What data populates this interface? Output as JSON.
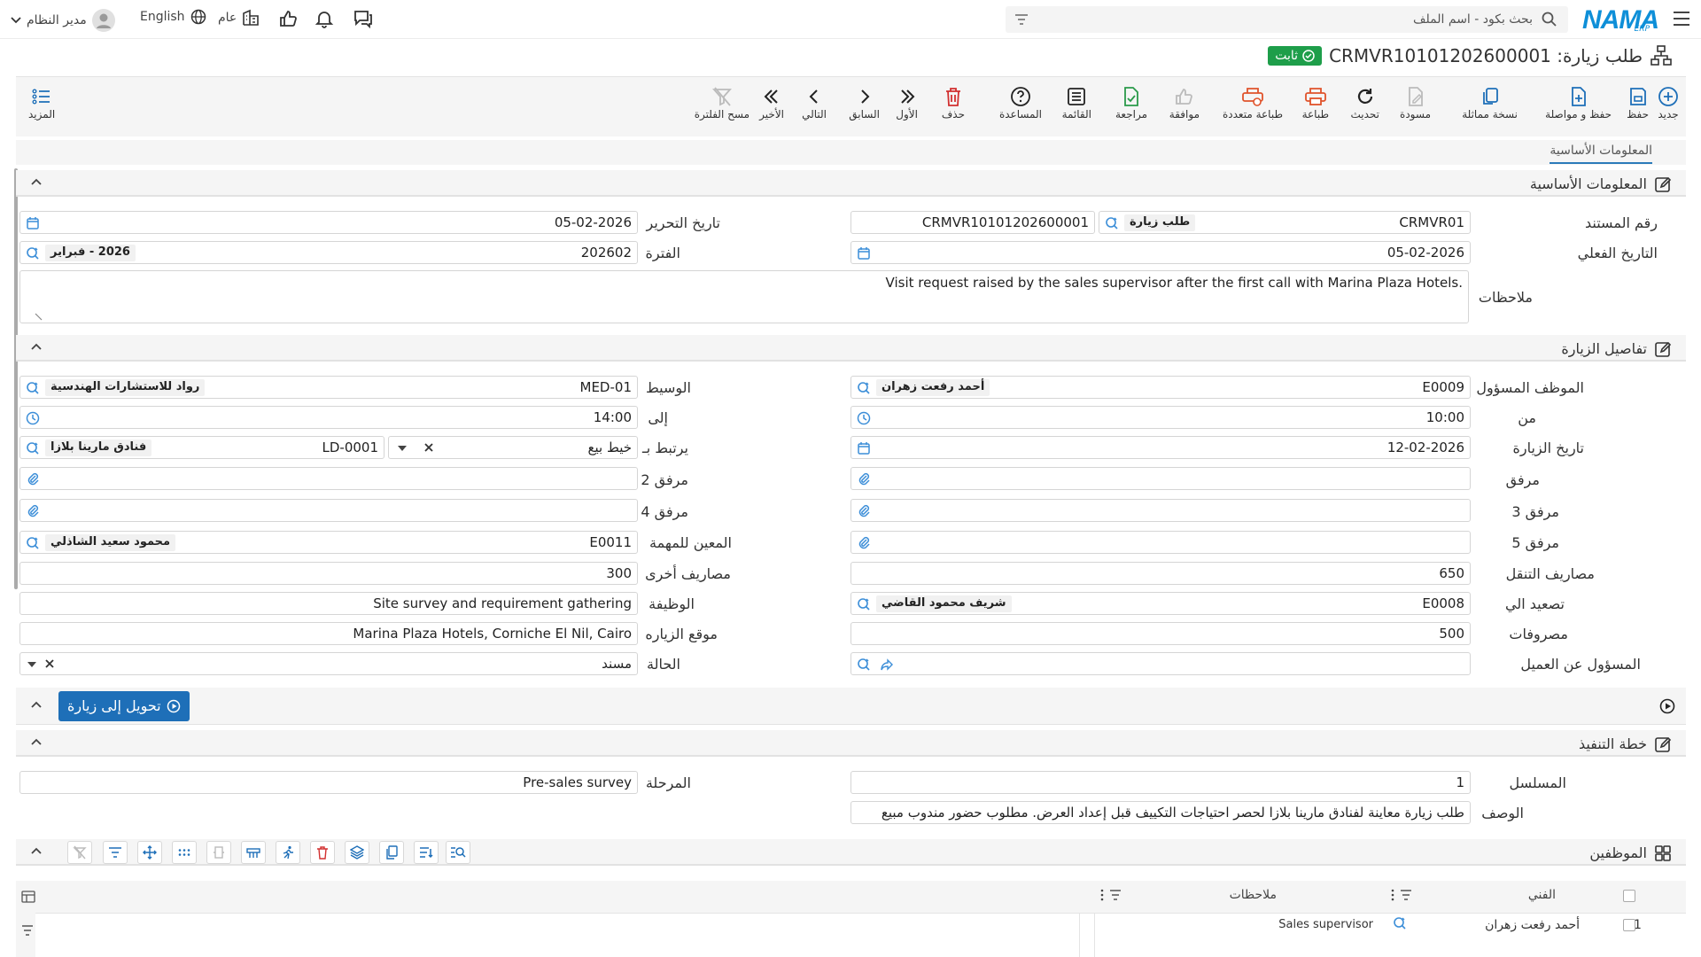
{
  "topbar": {
    "search_placeholder": "بحث بكود - اسم الملف",
    "user": "مدير النظام",
    "language": "English",
    "scope": "عام",
    "logo": "NAMA",
    "logo_sub": "ERP"
  },
  "title": {
    "text": "طلب زيارة: CRMVR10101202600001",
    "status": "ثابت"
  },
  "toolbar": {
    "new": "جديد",
    "save": "حفظ",
    "save_continue": "حفظ و مواصلة",
    "copy": "نسخة مماثلة",
    "draft": "مسودة",
    "refresh": "تحديث",
    "print": "طباعة",
    "multi_print": "طباعة متعددة",
    "approve": "موافقة",
    "review": "مراجعة",
    "list": "القائمة",
    "help": "المساعدة",
    "delete": "حذف",
    "first": "الأول",
    "prev": "السابق",
    "next": "التالي",
    "last": "الأخير",
    "clear_filter": "مسح الفلترة",
    "more": "المزيد"
  },
  "tabs": [
    "المعلومات الأساسية"
  ],
  "sections": {
    "basic": "المعلومات الأساسية",
    "visit": "تفاصيل الزيارة",
    "plan": "خطة التنفيذ",
    "employees": "الموظفين"
  },
  "basic": {
    "doc_no_label": "رقم المستند",
    "doc_code": "CRMVR01",
    "doc_type": "طلب زيارة",
    "doc_no": "CRMVR10101202600001",
    "edit_date_label": "تاريخ التحرير",
    "edit_date": "05-02-2026",
    "actual_date_label": "التاريخ الفعلي",
    "actual_date": "05-02-2026",
    "period_label": "الفترة",
    "period_code": "202602",
    "period_name": "2026 - فبراير",
    "notes_label": "ملاحظات",
    "notes": "Visit request raised by the sales supervisor after the first call with Marina Plaza Hotels."
  },
  "visit": {
    "employee_label": "الموظف المسؤول",
    "employee_code": "E0009",
    "employee_name": "أحمد رفعت زهران",
    "broker_label": "الوسيط",
    "broker_code": "MED-01",
    "broker_name": "رواد للاستشارات الهندسية",
    "from_label": "من",
    "from": "10:00",
    "to_label": "إلى",
    "to": "14:00",
    "visit_date_label": "تاريخ الزيارة",
    "visit_date": "12-02-2026",
    "linked_label": "يرتبط بـ",
    "linked_type": "خيط بيع",
    "linked_code": "LD-0001",
    "linked_name": "فنادق مارينا بلازا",
    "attach_label": "مرفق",
    "attach2_label": "مرفق 2",
    "attach3_label": "مرفق 3",
    "attach4_label": "مرفق 4",
    "attach5_label": "مرفق 5",
    "assignee_label": "المعين للمهمة",
    "assignee_code": "E0011",
    "assignee_name": "محمود سعيد الشاذلي",
    "transport_label": "مصاريف التنقل",
    "transport": "650",
    "other_exp_label": "مصاريف أخرى",
    "other_exp": "300",
    "escalate_label": "تصعيد الي",
    "escalate_code": "E0008",
    "escalate_name": "شريف محمود القاضي",
    "job_label": "الوظيفة",
    "job": "Site survey and requirement gathering",
    "expenses_label": "مصروفات",
    "expenses": "500",
    "location_label": "موقع الزياره",
    "location": "Marina Plaza Hotels, Corniche El Nil, Cairo",
    "customer_owner_label": "المسؤول عن العميل",
    "status_label": "الحالة",
    "status": "مسند",
    "convert_button": "تحويل إلى زيارة"
  },
  "plan": {
    "serial_label": "المسلسل",
    "serial": "1",
    "stage_label": "المرحلة",
    "stage": "Pre-sales survey",
    "desc_label": "الوصف",
    "desc": "طلب زيارة معاينة لفنادق مارينا بلازا لحصر احتياجات التكييف قبل إعداد العرض. مطلوب حضور مندوب مبيع"
  },
  "grid": {
    "col_tech": "الفني",
    "col_notes": "ملاحظات",
    "rows": [
      {
        "no": "1",
        "tech": "أحمد رفعت زهران",
        "notes": "Sales supervisor"
      }
    ]
  }
}
